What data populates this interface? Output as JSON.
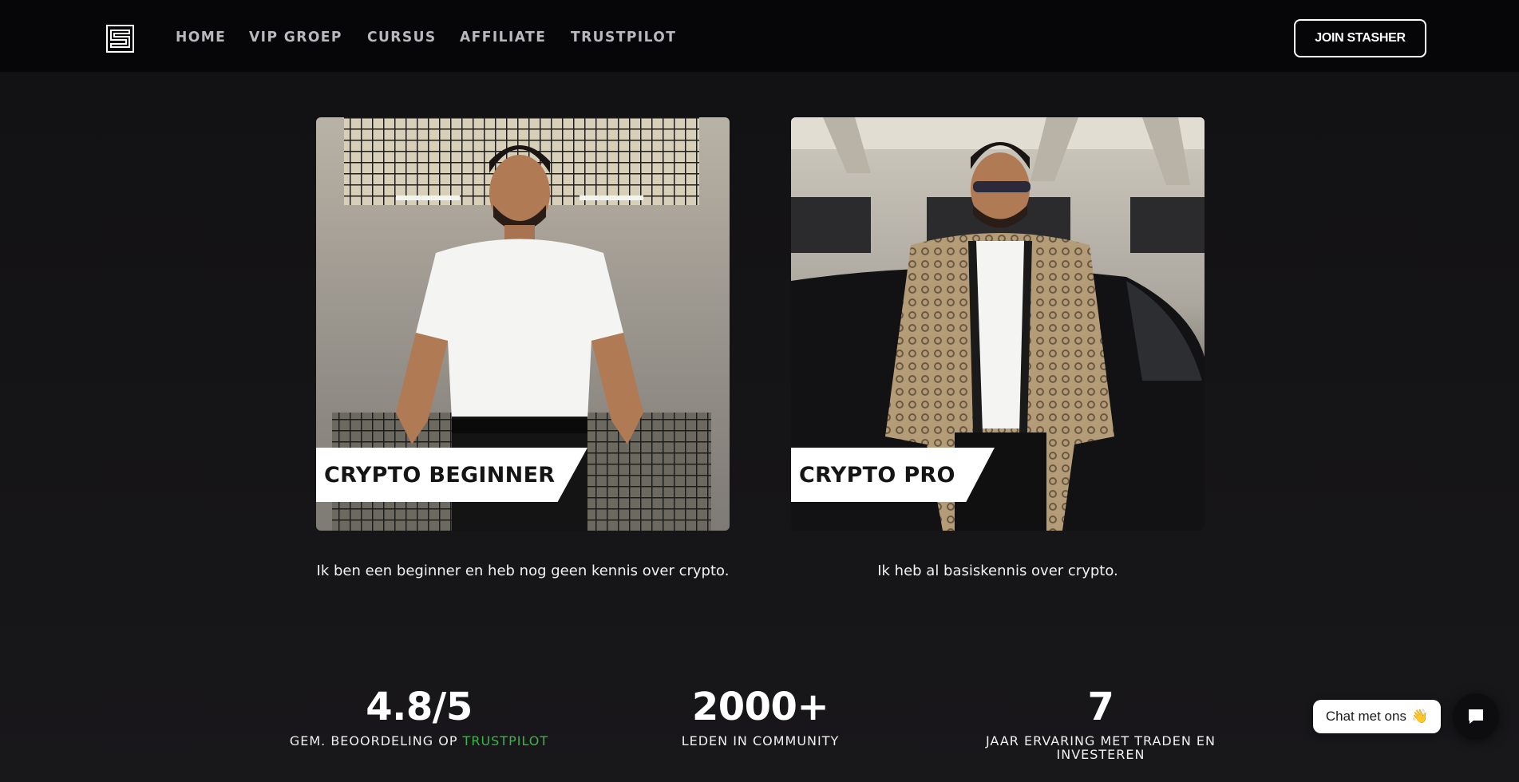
{
  "nav": {
    "items": [
      {
        "label": "HOME"
      },
      {
        "label": "VIP GROEP"
      },
      {
        "label": "CURSUS"
      },
      {
        "label": "AFFILIATE"
      },
      {
        "label": "TRUSTPILOT"
      }
    ],
    "cta_label": "JOIN STASHER",
    "logo_icon": "stasher-s-logo-icon"
  },
  "cards": [
    {
      "title": "CRYPTO BEGINNER",
      "description": "Ik ben een beginner en heb nog geen kennis over crypto."
    },
    {
      "title": "CRYPTO PRO",
      "description": "Ik heb al basiskennis over crypto."
    }
  ],
  "stats": [
    {
      "value": "4.8/5",
      "label_prefix": "GEM. BEOORDELING OP ",
      "label_accent": "TRUSTPILOT"
    },
    {
      "value": "2000+",
      "label": "LEDEN IN COMMUNITY"
    },
    {
      "value": "7",
      "label": "JAAR ERVARING MET TRADEN EN INVESTEREN"
    }
  ],
  "chat": {
    "bubble_text": "Chat met ons",
    "bubble_emoji": "👋",
    "launcher_icon": "chat-icon"
  },
  "colors": {
    "accent": "#3bb54a",
    "background": "#141315"
  }
}
